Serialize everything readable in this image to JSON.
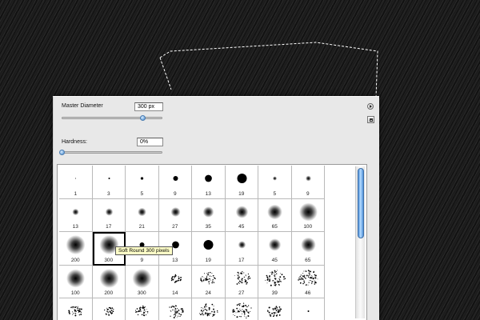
{
  "panel": {
    "master_diameter_label": "Master Diameter",
    "master_diameter_value": "300 px",
    "master_diameter_slider_fraction": 0.8,
    "hardness_label": "Hardness:",
    "hardness_value": "0%",
    "hardness_slider_fraction": 0.0,
    "menu_button_icon": "flyout-arrow-icon",
    "new_preset_icon": "new-preset-icon"
  },
  "tooltip": "Soft Round 300 pixels",
  "scrollbar_position_fraction": 0.0,
  "colors": {
    "accent": "#5b9be0",
    "tooltip_bg": "#ffffc8"
  },
  "brushes": [
    {
      "label": "1",
      "kind": "hard",
      "size": 1
    },
    {
      "label": "3",
      "kind": "hard",
      "size": 3
    },
    {
      "label": "5",
      "kind": "hard",
      "size": 5
    },
    {
      "label": "9",
      "kind": "hard",
      "size": 9
    },
    {
      "label": "13",
      "kind": "hard",
      "size": 13
    },
    {
      "label": "19",
      "kind": "hard",
      "size": 19
    },
    {
      "label": "5",
      "kind": "soft",
      "size": 5
    },
    {
      "label": "9",
      "kind": "soft",
      "size": 9
    },
    {
      "label": "13",
      "kind": "soft",
      "size": 13
    },
    {
      "label": "17",
      "kind": "soft",
      "size": 17
    },
    {
      "label": "21",
      "kind": "soft",
      "size": 21
    },
    {
      "label": "27",
      "kind": "soft",
      "size": 27
    },
    {
      "label": "35",
      "kind": "soft",
      "size": 35
    },
    {
      "label": "45",
      "kind": "soft",
      "size": 45
    },
    {
      "label": "65",
      "kind": "soft",
      "size": 65
    },
    {
      "label": "100",
      "kind": "soft",
      "size": 100
    },
    {
      "label": "200",
      "kind": "soft",
      "size": 200
    },
    {
      "label": "300",
      "kind": "soft",
      "size": 300,
      "selected": true
    },
    {
      "label": "9",
      "kind": "hard",
      "size": 9
    },
    {
      "label": "13",
      "kind": "hard",
      "size": 13
    },
    {
      "label": "19",
      "kind": "hard",
      "size": 19
    },
    {
      "label": "17",
      "kind": "soft",
      "size": 17
    },
    {
      "label": "45",
      "kind": "soft",
      "size": 45
    },
    {
      "label": "65",
      "kind": "soft",
      "size": 65
    },
    {
      "label": "100",
      "kind": "soft",
      "size": 100
    },
    {
      "label": "200",
      "kind": "soft",
      "size": 200
    },
    {
      "label": "300",
      "kind": "soft",
      "size": 300
    },
    {
      "label": "14",
      "kind": "scatter",
      "size": 14
    },
    {
      "label": "24",
      "kind": "scatter",
      "size": 24
    },
    {
      "label": "27",
      "kind": "scatter",
      "size": 27
    },
    {
      "label": "39",
      "kind": "scatter",
      "size": 39
    },
    {
      "label": "46",
      "kind": "scatter",
      "size": 46
    },
    {
      "label": "",
      "kind": "scatter",
      "size": 20
    },
    {
      "label": "",
      "kind": "scatter",
      "size": 12
    },
    {
      "label": "",
      "kind": "scatter",
      "size": 18
    },
    {
      "label": "",
      "kind": "scatter",
      "size": 26
    },
    {
      "label": "",
      "kind": "scatter",
      "size": 30
    },
    {
      "label": "",
      "kind": "scatter",
      "size": 34
    },
    {
      "label": "",
      "kind": "scatter",
      "size": 22
    },
    {
      "label": "",
      "kind": "hard",
      "size": 3
    }
  ]
}
